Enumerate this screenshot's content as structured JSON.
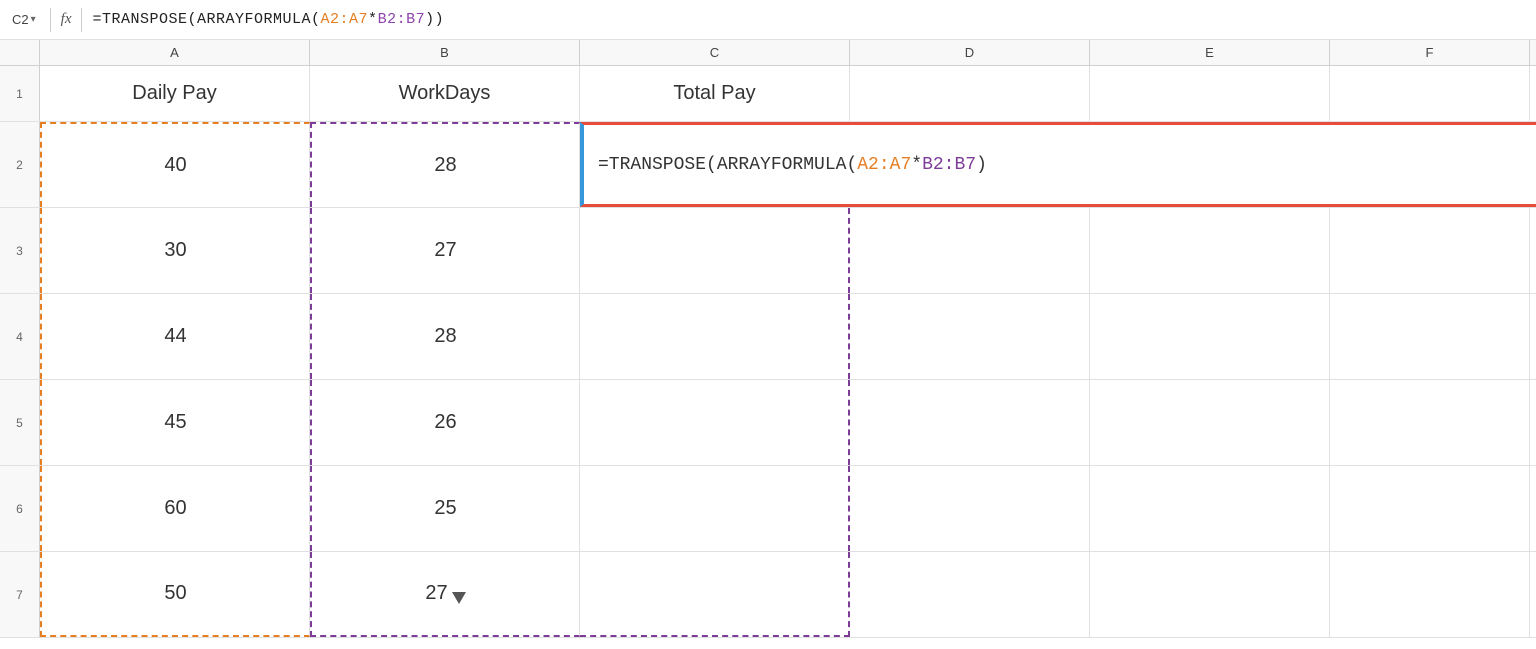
{
  "formulaBar": {
    "cellRef": "C2",
    "fxLabel": "fx",
    "formula": "=TRANSPOSE(ARRAYFORMULA(A2:A7*B2:B7))",
    "formulaParts": [
      {
        "text": "=TRANSPOSE(ARRAYFORMULA(",
        "color": "black"
      },
      {
        "text": "A2:A7",
        "color": "orange"
      },
      {
        "text": "*",
        "color": "black"
      },
      {
        "text": "B2:B7",
        "color": "purple"
      },
      {
        "text": ")",
        "color": "black"
      }
    ]
  },
  "columns": {
    "headers": [
      "A",
      "B",
      "C",
      "D",
      "E",
      "F"
    ],
    "widths": [
      270,
      270,
      270,
      240,
      240,
      200
    ]
  },
  "rows": [
    {
      "rowNum": "1",
      "cells": [
        "Daily Pay",
        "WorkDays",
        "Total Pay",
        "",
        "",
        ""
      ]
    },
    {
      "rowNum": "2",
      "cells": [
        "40",
        "28",
        "=TRANSPOSE(ARRAYFORMULA(A2:A7*B2:B7))",
        "",
        "",
        ""
      ]
    },
    {
      "rowNum": "3",
      "cells": [
        "30",
        "27",
        "",
        "",
        "",
        ""
      ]
    },
    {
      "rowNum": "4",
      "cells": [
        "44",
        "28",
        "",
        "",
        "",
        ""
      ]
    },
    {
      "rowNum": "5",
      "cells": [
        "45",
        "26",
        "",
        "",
        "",
        ""
      ]
    },
    {
      "rowNum": "6",
      "cells": [
        "60",
        "25",
        "",
        "",
        "",
        ""
      ]
    },
    {
      "rowNum": "7",
      "cells": [
        "50",
        "27",
        "",
        "",
        "",
        ""
      ]
    }
  ],
  "colors": {
    "orange": "#E67E22",
    "purple": "#7D3C98",
    "red": "#E74C3C",
    "blue": "#3498DB",
    "headerBg": "#f8f8f8",
    "gridLine": "#e0e0e0"
  }
}
